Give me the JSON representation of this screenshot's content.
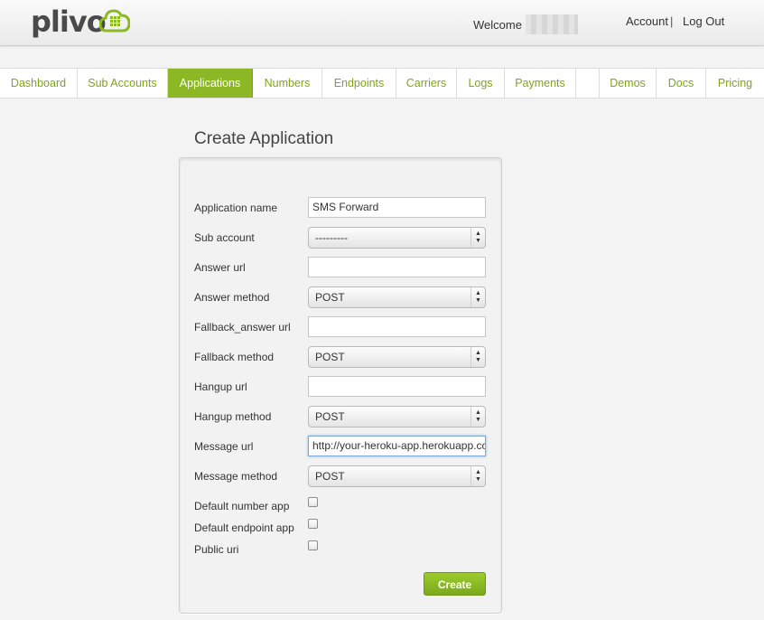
{
  "header": {
    "logo_text": "plivo",
    "logo_icon": "cloud-grid-icon",
    "welcome_label": "Welcome",
    "account_link": "Account",
    "account_separator": "|",
    "logout_link": "Log Out"
  },
  "nav": {
    "items": [
      {
        "label": "Dashboard"
      },
      {
        "label": "Sub Accounts"
      },
      {
        "label": "Applications",
        "active": true
      },
      {
        "label": "Numbers"
      },
      {
        "label": "Endpoints"
      },
      {
        "label": "Carriers"
      },
      {
        "label": "Logs"
      },
      {
        "label": "Payments"
      },
      {
        "label": ""
      },
      {
        "label": "Demos"
      },
      {
        "label": "Docs"
      },
      {
        "label": "Pricing"
      }
    ]
  },
  "page": {
    "title": "Create Application"
  },
  "form": {
    "app_name": {
      "label": "Application name",
      "value": "SMS Forward"
    },
    "sub_account": {
      "label": "Sub account",
      "value": "---------"
    },
    "answer_url": {
      "label": "Answer url",
      "value": ""
    },
    "answer_method": {
      "label": "Answer method",
      "value": "POST"
    },
    "fallback_url": {
      "label": "Fallback_answer url",
      "value": ""
    },
    "fallback_method": {
      "label": "Fallback method",
      "value": "POST"
    },
    "hangup_url": {
      "label": "Hangup url",
      "value": ""
    },
    "hangup_method": {
      "label": "Hangup method",
      "value": "POST"
    },
    "message_url": {
      "label": "Message url",
      "value": "http://your-heroku-app.herokuapp.com"
    },
    "message_method": {
      "label": "Message method",
      "value": "POST"
    },
    "default_number_app": {
      "label": "Default number app",
      "checked": false
    },
    "default_endpoint_app": {
      "label": "Default endpoint app",
      "checked": false
    },
    "public_uri": {
      "label": "Public uri",
      "checked": false
    },
    "create_label": "Create"
  },
  "colors": {
    "brand_green": "#8cb826",
    "nav_text": "#7fa516",
    "logo_gray": "#4a4a4a"
  }
}
